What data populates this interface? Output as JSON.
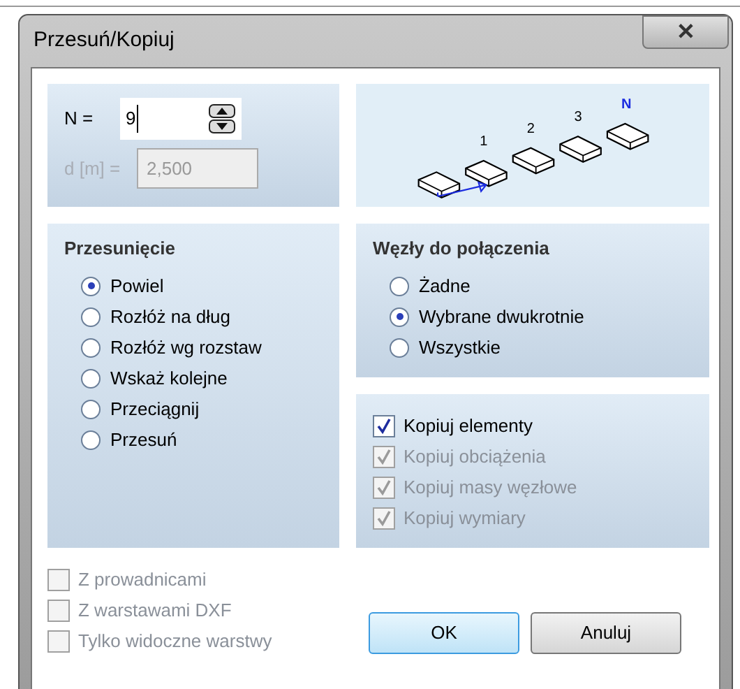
{
  "window": {
    "title": "Przesuń/Kopiuj",
    "close": "✕"
  },
  "count": {
    "label": "N =",
    "value": "9"
  },
  "distance": {
    "label": "d [m] =",
    "value": "2,500",
    "disabled": true
  },
  "diagram": {
    "labels": [
      "1",
      "2",
      "3",
      "N"
    ]
  },
  "displacement": {
    "title": "Przesunięcie",
    "options": [
      {
        "label": "Powiel",
        "selected": true
      },
      {
        "label": "Rozłóż na dług",
        "selected": false
      },
      {
        "label": "Rozłóż wg rozstaw",
        "selected": false
      },
      {
        "label": "Wskaż kolejne",
        "selected": false
      },
      {
        "label": "Przeciągnij",
        "selected": false
      },
      {
        "label": "Przesuń",
        "selected": false
      }
    ]
  },
  "nodes": {
    "title": "Węzły do połączenia",
    "options": [
      {
        "label": "Żadne",
        "selected": false
      },
      {
        "label": "Wybrane dwukrotnie",
        "selected": true
      },
      {
        "label": "Wszystkie",
        "selected": false
      }
    ]
  },
  "copy_options": [
    {
      "label": "Kopiuj elementy",
      "checked": true,
      "disabled": false
    },
    {
      "label": "Kopiuj obciążenia",
      "checked": true,
      "disabled": true
    },
    {
      "label": "Kopiuj masy węzłowe",
      "checked": true,
      "disabled": true
    },
    {
      "label": "Kopiuj wymiary",
      "checked": true,
      "disabled": true
    }
  ],
  "extra_options": [
    {
      "label": "Z prowadnicami",
      "checked": false,
      "disabled": true
    },
    {
      "label": "Z warstawami DXF",
      "checked": false,
      "disabled": true
    },
    {
      "label": "Tylko widoczne warstwy",
      "checked": false,
      "disabled": true
    }
  ],
  "buttons": [
    {
      "label": "OK",
      "default": true
    },
    {
      "label": "Anuluj",
      "default": false
    }
  ]
}
